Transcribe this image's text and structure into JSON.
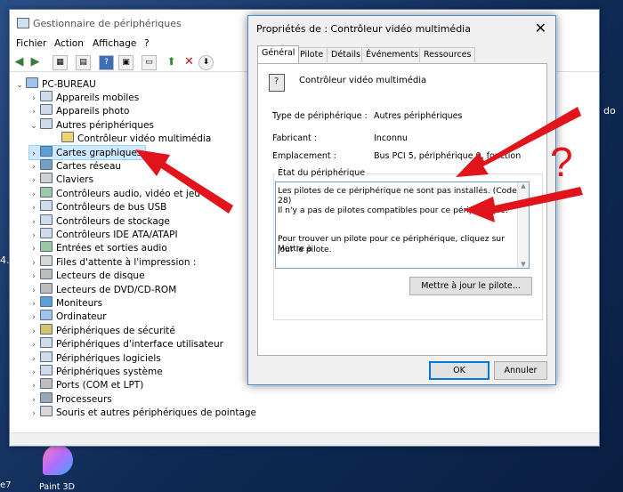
{
  "window": {
    "title": "Gestionnaire de périphériques",
    "menu": [
      "Fichier",
      "Action",
      "Affichage",
      "?"
    ]
  },
  "tree": {
    "root": "PC-BUREAU",
    "items": [
      {
        "label": "Appareils mobiles",
        "chevron": "›"
      },
      {
        "label": "Appareils photo",
        "chevron": "›"
      },
      {
        "label": "Autres périphériques",
        "chevron": "⌄"
      },
      {
        "label": "Contrôleur vidéo multimédia",
        "chevron": ""
      },
      {
        "label": "Cartes graphiques",
        "chevron": "›"
      },
      {
        "label": "Cartes réseau",
        "chevron": "›"
      },
      {
        "label": "Claviers",
        "chevron": "›"
      },
      {
        "label": "Contrôleurs audio, vidéo et jeu",
        "chevron": "›"
      },
      {
        "label": "Contrôleurs de bus USB",
        "chevron": "›"
      },
      {
        "label": "Contrôleurs de stockage",
        "chevron": "›"
      },
      {
        "label": "Contrôleurs IDE ATA/ATAPI",
        "chevron": "›"
      },
      {
        "label": "Entrées et sorties audio",
        "chevron": "›"
      },
      {
        "label": "Files d'attente à l'impression :",
        "chevron": "›"
      },
      {
        "label": "Lecteurs de disque",
        "chevron": "›"
      },
      {
        "label": "Lecteurs de DVD/CD-ROM",
        "chevron": "›"
      },
      {
        "label": "Moniteurs",
        "chevron": "›"
      },
      {
        "label": "Ordinateur",
        "chevron": "›"
      },
      {
        "label": "Périphériques de sécurité",
        "chevron": "›"
      },
      {
        "label": "Périphériques d'interface utilisateur",
        "chevron": "›"
      },
      {
        "label": "Périphériques logiciels",
        "chevron": "›"
      },
      {
        "label": "Périphériques système",
        "chevron": "›"
      },
      {
        "label": "Ports (COM et LPT)",
        "chevron": "›"
      },
      {
        "label": "Processeurs",
        "chevron": "›"
      },
      {
        "label": "Souris et autres périphériques de pointage",
        "chevron": "›"
      }
    ]
  },
  "dialog": {
    "title": "Propriétés de : Contrôleur vidéo multimédia",
    "close": "✕",
    "tabs": [
      "Général",
      "Pilote",
      "Détails",
      "Événements",
      "Ressources"
    ],
    "device_name": "Contrôleur vidéo multimédia",
    "type_label": "Type de périphérique :",
    "type_value": "Autres périphériques",
    "maker_label": "Fabricant :",
    "maker_value": "Inconnu",
    "location_label": "Emplacement :",
    "location_value": "Bus PCI 5, périphérique 0, fonction",
    "status_group": "État du périphérique",
    "status_line1": "Les pilotes de ce périphérique ne sont pas installés. (Code 28)",
    "status_line2": "Il n'y a pas de pilotes compatibles pour ce périphérique.",
    "status_line3": "Pour trouver un pilote pour ce périphérique, cliquez sur Mettre à",
    "status_line4": "jour le pilote.",
    "update_button": "Mettre à jour le pilote...",
    "ok_button": "OK",
    "cancel_button": "Annuler"
  },
  "desktop": {
    "paint3d_label": "Paint 3D",
    "edge_label_left": "e7",
    "edge_label_top": "do",
    "edge_label_mid": "4."
  },
  "annotation": {
    "question_mark": "?",
    "color": "#e0141a"
  }
}
